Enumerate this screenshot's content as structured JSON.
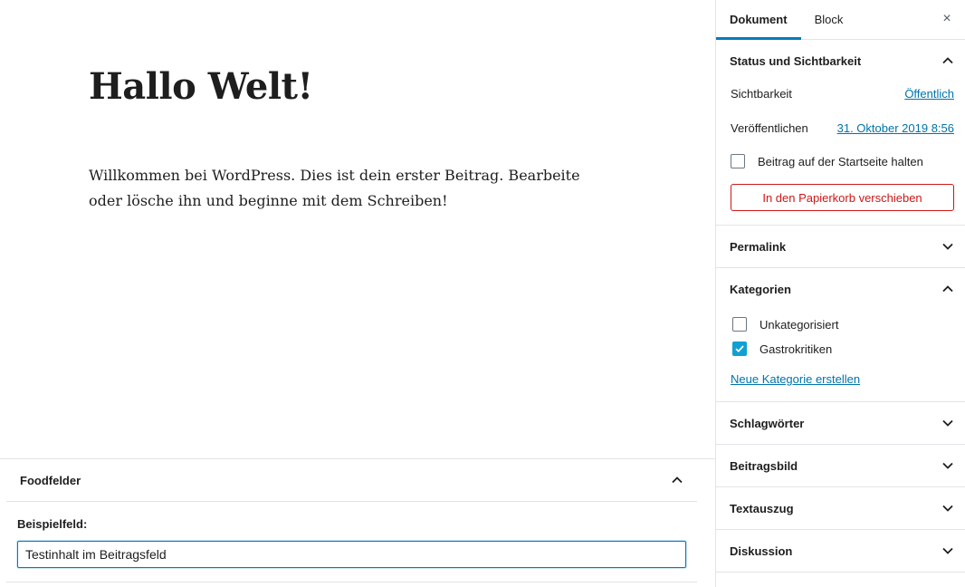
{
  "editor": {
    "post_title": "Hallo Welt!",
    "post_content": "Willkommen bei WordPress. Dies ist dein erster Beitrag. Bearbeite oder lösche ihn und beginne mit dem Schreiben!"
  },
  "metabox": {
    "title": "Foodfelder",
    "field_label": "Beispielfeld:",
    "field_value": "Testinhalt im Beitragsfeld"
  },
  "sidebar": {
    "tabs": [
      {
        "label": "Dokument",
        "active": true
      },
      {
        "label": "Block",
        "active": false
      }
    ],
    "close_icon": "×",
    "status": {
      "title": "Status und Sichtbarkeit",
      "visibility_label": "Sichtbarkeit",
      "visibility_value": "Öffentlich",
      "publish_label": "Veröffentlichen",
      "publish_value": "31. Oktober 2019 8:56",
      "sticky_label": "Beitrag auf der Startseite halten",
      "trash_label": "In den Papierkorb verschieben"
    },
    "permalink": {
      "title": "Permalink"
    },
    "categories": {
      "title": "Kategorien",
      "items": [
        {
          "label": "Unkategorisiert",
          "checked": false
        },
        {
          "label": "Gastrokritiken",
          "checked": true
        }
      ],
      "new_link": "Neue Kategorie erstellen"
    },
    "tags": {
      "title": "Schlagwörter"
    },
    "featured_image": {
      "title": "Beitragsbild"
    },
    "excerpt": {
      "title": "Textauszug"
    },
    "discussion": {
      "title": "Diskussion"
    }
  },
  "colors": {
    "accent": "#007cba",
    "link": "#0073aa",
    "danger": "#cc1818",
    "checkbox_checked": "#11a0d2"
  }
}
